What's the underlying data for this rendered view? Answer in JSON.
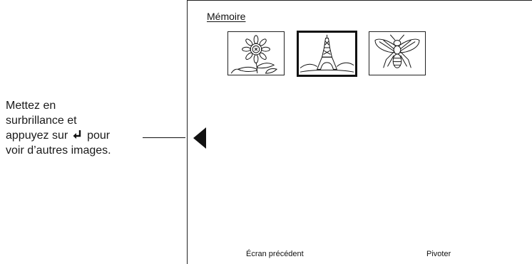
{
  "callout": {
    "line1": "Mettez en",
    "line2": "surbrillance et",
    "line3_before": "appuyez sur",
    "line3_after": "pour",
    "line4": "voir d’autres images.",
    "enter_icon": "enter-return-icon"
  },
  "screen": {
    "title": "Mémoire",
    "thumbnails": [
      {
        "subject": "sunflower",
        "selected": false
      },
      {
        "subject": "eiffel-tower",
        "selected": true
      },
      {
        "subject": "fly",
        "selected": false
      }
    ],
    "nav_icon": "triangle-left-icon",
    "softkeys": {
      "back": "Écran précédent",
      "rotate": "Pivoter"
    }
  }
}
